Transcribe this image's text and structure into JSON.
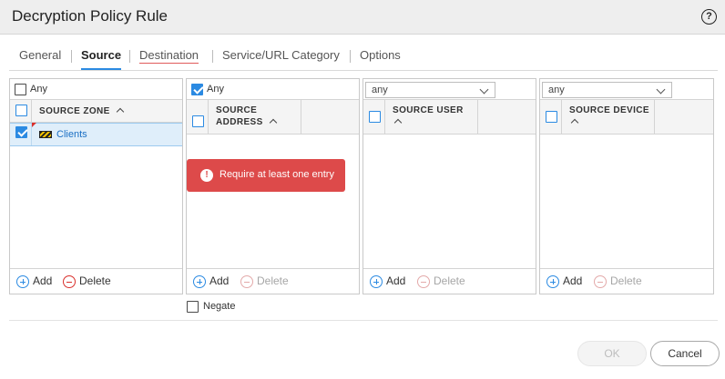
{
  "dialog": {
    "title": "Decryption Policy Rule",
    "help_icon": "help-icon",
    "help_glyph": "?"
  },
  "tabs": [
    {
      "label": "General",
      "active": false
    },
    {
      "label": "Source",
      "active": true
    },
    {
      "label": "Destination",
      "active": false,
      "error": true
    },
    {
      "label": "Service/URL Category",
      "active": false
    },
    {
      "label": "Options",
      "active": false
    }
  ],
  "source_zone": {
    "any_label": "Any",
    "any_checked": false,
    "header": "SOURCE ZONE",
    "rows": [
      {
        "label": "Clients",
        "checked": true,
        "icon": "zone-icon"
      }
    ],
    "add_label": "Add",
    "delete_label": "Delete"
  },
  "source_address": {
    "any_label": "Any",
    "any_checked": true,
    "header_line1": "SOURCE",
    "header_line2": "ADDRESS",
    "add_label": "Add",
    "delete_label": "Delete"
  },
  "source_user": {
    "select_value": "any",
    "header": "SOURCE USER",
    "add_label": "Add",
    "delete_label": "Delete"
  },
  "source_device": {
    "select_value": "any",
    "header": "SOURCE DEVICE",
    "add_label": "Add",
    "delete_label": "Delete"
  },
  "error_tooltip": {
    "glyph": "!",
    "text": "Require at least one entry"
  },
  "negate": {
    "label": "Negate",
    "checked": false
  },
  "buttons": {
    "ok": "OK",
    "cancel": "Cancel"
  },
  "colors": {
    "accent": "#2b8ae2",
    "error": "#dd4a4a",
    "selected_row": "#dfeefa"
  }
}
